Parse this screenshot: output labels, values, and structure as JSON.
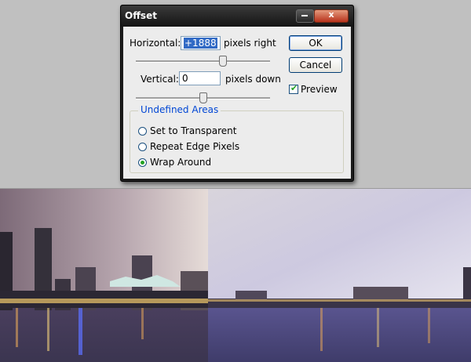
{
  "dialog": {
    "title": "Offset",
    "close_glyph": "x",
    "horizontal": {
      "label": "Horizontal:",
      "value": "+1888",
      "unit": "pixels right",
      "slider_fraction": 0.66
    },
    "vertical": {
      "label": "Vertical:",
      "value": "0",
      "unit": "pixels down",
      "slider_fraction": 0.5
    },
    "ok_label": "OK",
    "cancel_label": "Cancel",
    "preview": {
      "label": "Preview",
      "checked": true
    },
    "undefined_areas": {
      "title": "Undefined Areas",
      "options": [
        "Set to Transparent",
        "Repeat Edge Pixels",
        "Wrap Around"
      ],
      "selected": "Wrap Around"
    }
  },
  "colors": {
    "accent": "#0046d5",
    "selection": "#316ac5",
    "check": "#21a121"
  }
}
